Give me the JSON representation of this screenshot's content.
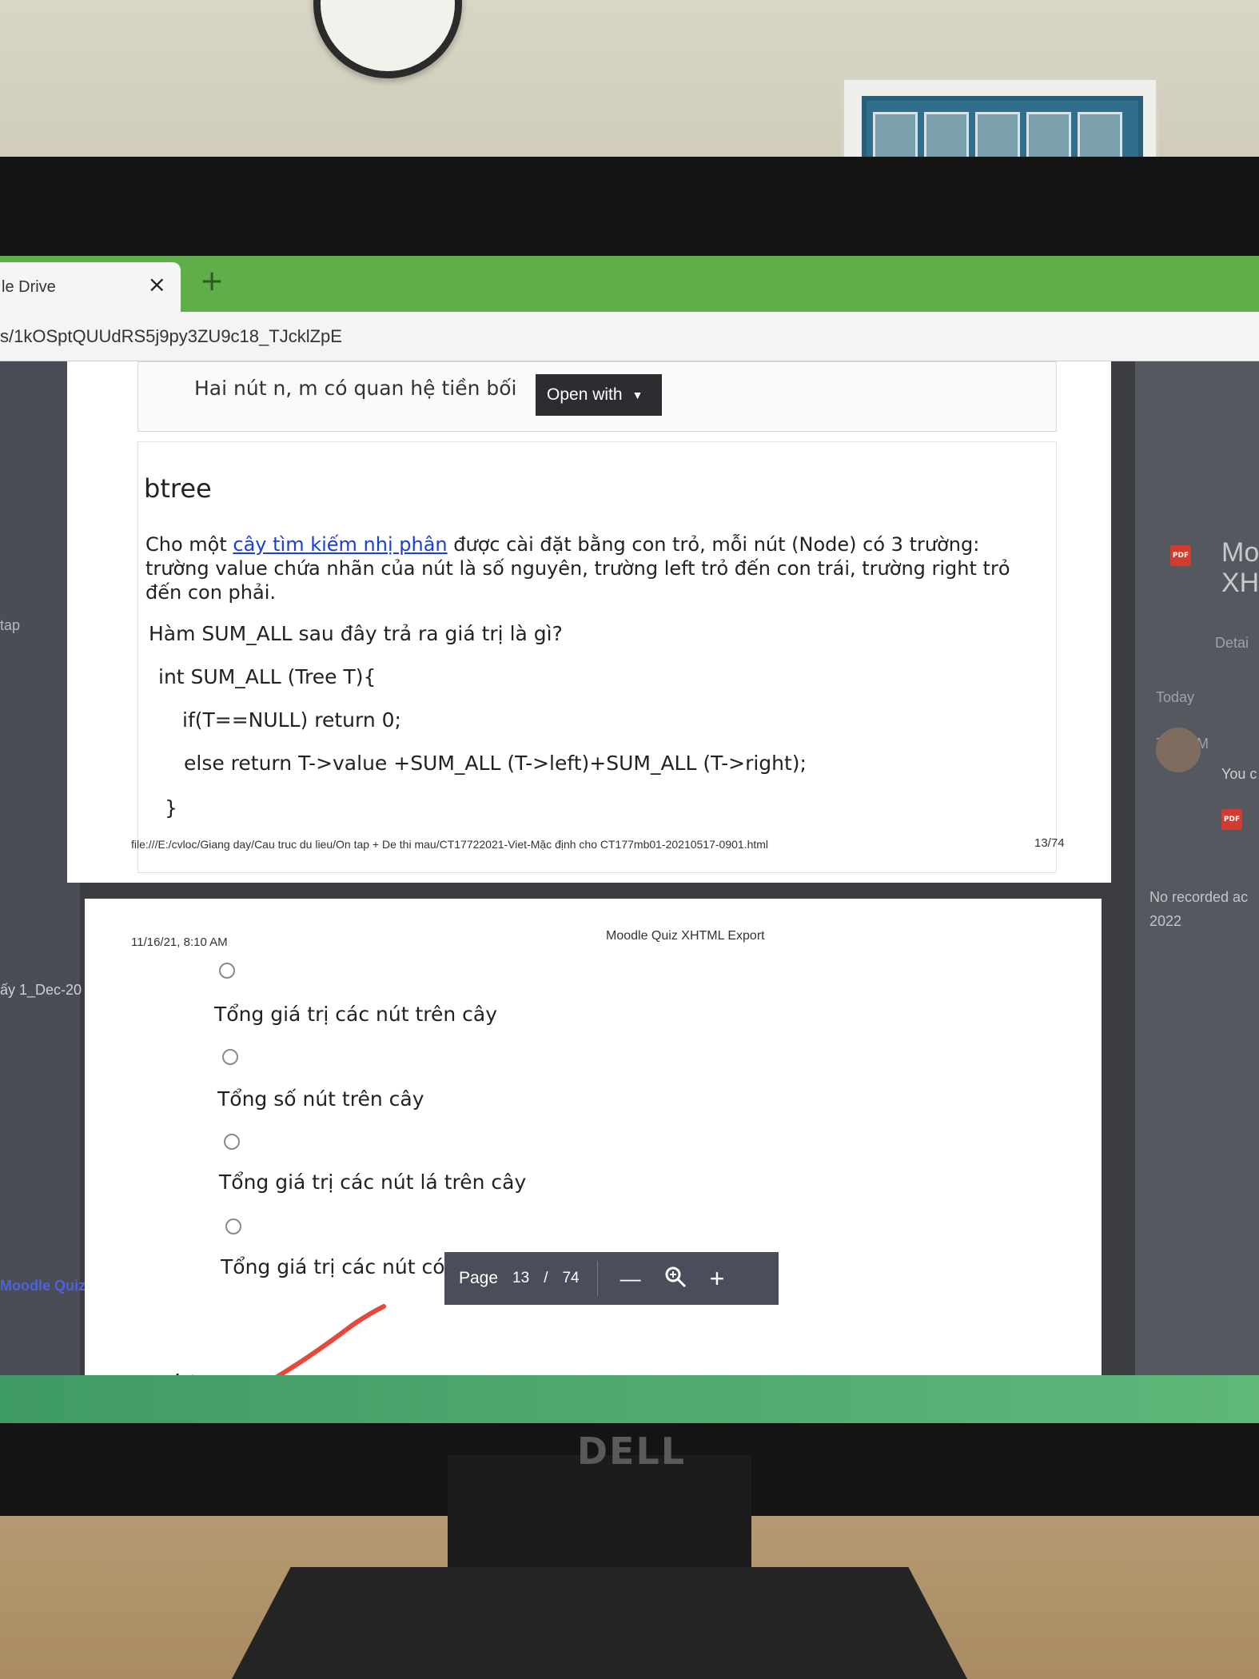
{
  "browser": {
    "tab_title": "le Drive",
    "tab_close": "×",
    "new_tab": "+",
    "address": "s/1kOSptQUUdRS5j9py3ZU9c18_TJcklZpE"
  },
  "viewer": {
    "open_with": "Open with",
    "left_panel": {
      "label_tap": "tap",
      "label_dec": "ấy 1_Dec-20",
      "label_quiz": "Moodle Quiz"
    },
    "right_panel": {
      "file_title_1": "Mo",
      "file_title_2": "XH",
      "details": "Detai",
      "today": "Today",
      "time": "7:06 AM",
      "you": "You c",
      "no_activity": "No recorded ac",
      "year": "2022"
    },
    "toolbar": {
      "page_label": "Page",
      "current_page": "13",
      "separator": "/",
      "total_pages": "74",
      "zoom_out": "—",
      "zoom_in": "+"
    }
  },
  "page1": {
    "previous_answer": "Hai nút n, m có quan hệ tiền bối",
    "question_title": "btree",
    "intro_before_link": "Cho một ",
    "intro_link": "cây tìm kiếm nhị phân",
    "intro_after_link": " được cài đặt bằng con trỏ, mỗi nút (Node) có 3 trường: trường value chứa nhãn của nút là số nguyên, trường left trỏ đến con trái, trường right trỏ đến con phải.",
    "question": "Hàm SUM_ALL sau đây trả ra giá trị là gì?",
    "code_1": "int SUM_ALL (Tree T){",
    "code_2": "if(T==NULL) return 0;",
    "code_3": "else return T->value +SUM_ALL (T->left)+SUM_ALL (T->right);",
    "code_4": "}",
    "footer_path": "file:///E:/cvloc/Giang day/Cau truc du lieu/On tap + De thi mau/CT17722021-Viet-Mặc định cho CT177mb01-20210517-0901.html",
    "footer_page": "13/74"
  },
  "page2": {
    "header_date": "11/16/21, 8:10 AM",
    "header_title": "Moodle Quiz XHTML Export",
    "answers": [
      "Tổng giá trị các nút trên cây",
      "Tổng số nút trên cây",
      "Tổng giá trị các nút lá trên cây",
      "Tổng giá trị các nút có hai nút con trên cây"
    ],
    "next_title": "btree"
  },
  "monitor": {
    "brand": "DELL"
  },
  "colors": {
    "tab_bar": "#5fae4a",
    "link": "#1a3fd6",
    "annotation_stroke": "#e8473c"
  }
}
